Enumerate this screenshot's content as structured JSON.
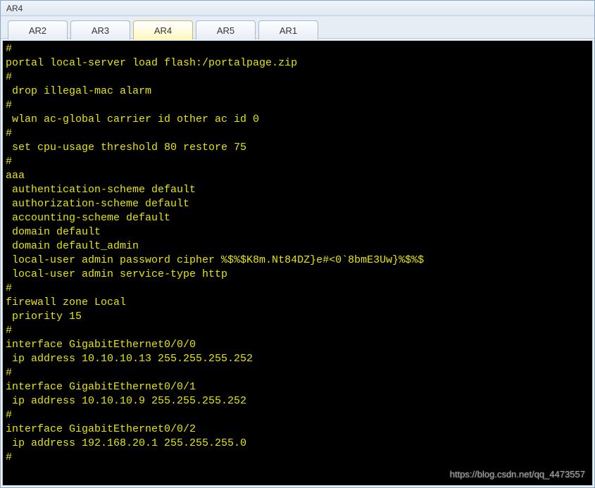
{
  "window": {
    "title": "AR4"
  },
  "tabs": [
    {
      "label": "AR2",
      "active": false
    },
    {
      "label": "AR3",
      "active": false
    },
    {
      "label": "AR4",
      "active": true
    },
    {
      "label": "AR5",
      "active": false
    },
    {
      "label": "AR1",
      "active": false
    }
  ],
  "terminal": {
    "lines": [
      "#",
      "portal local-server load flash:/portalpage.zip",
      "#",
      " drop illegal-mac alarm",
      "#",
      " wlan ac-global carrier id other ac id 0",
      "#",
      " set cpu-usage threshold 80 restore 75",
      "#",
      "aaa",
      " authentication-scheme default",
      " authorization-scheme default",
      " accounting-scheme default",
      " domain default",
      " domain default_admin",
      " local-user admin password cipher %$%$K8m.Nt84DZ}e#<0`8bmE3Uw}%$%$",
      " local-user admin service-type http",
      "#",
      "firewall zone Local",
      " priority 15",
      "#",
      "interface GigabitEthernet0/0/0",
      " ip address 10.10.10.13 255.255.255.252",
      "#",
      "interface GigabitEthernet0/0/1",
      " ip address 10.10.10.9 255.255.255.252",
      "#",
      "interface GigabitEthernet0/0/2",
      " ip address 192.168.20.1 255.255.255.0",
      "#"
    ]
  },
  "watermark": "https://blog.csdn.net/qq_4473557"
}
